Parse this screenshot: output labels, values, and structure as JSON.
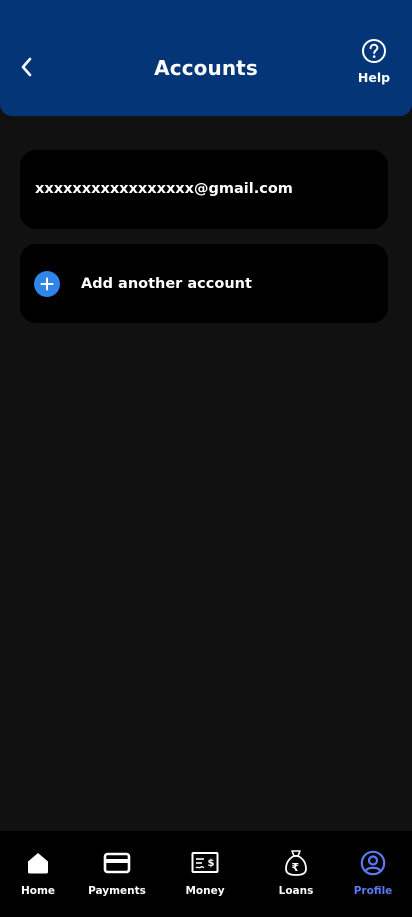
{
  "header": {
    "title": "Accounts",
    "help_label": "Help"
  },
  "account": {
    "email": "xxxxxxxxxxxxxxxxx@gmail.com"
  },
  "add_account": {
    "label": "Add another account"
  },
  "bottom_nav": {
    "items": [
      {
        "label": "Home",
        "icon": "home-icon"
      },
      {
        "label": "Payments",
        "icon": "card-icon"
      },
      {
        "label": "Money",
        "icon": "cheque-icon"
      },
      {
        "label": "Loans",
        "icon": "rupee-bag-icon"
      },
      {
        "label": "Profile",
        "icon": "profile-icon",
        "active": true
      }
    ]
  },
  "colors": {
    "header_bg": "#043677",
    "page_bg": "#111111",
    "card_bg": "#000000",
    "accent_blue": "#2f86e8",
    "active_nav": "#5a7bf0"
  }
}
